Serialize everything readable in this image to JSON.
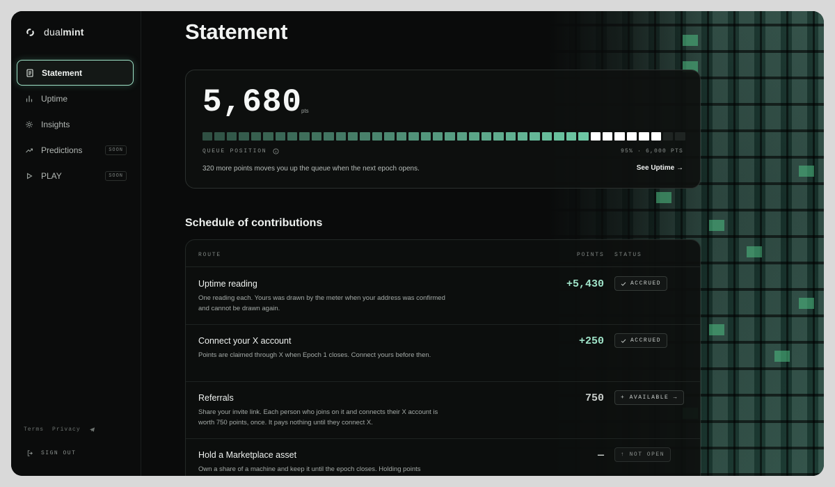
{
  "brand": {
    "prefix": "dual",
    "suffix": "mint"
  },
  "nav": [
    {
      "label": "Statement",
      "icon": "document-icon",
      "active": true
    },
    {
      "label": "Uptime",
      "icon": "bar-chart-icon"
    },
    {
      "label": "Insights",
      "icon": "sparkle-icon"
    },
    {
      "label": "Predictions",
      "icon": "trend-up-icon",
      "badge": "SOON"
    },
    {
      "label": "PLAY",
      "icon": "play-icon",
      "badge": "SOON"
    }
  ],
  "footer": {
    "terms": "Terms",
    "privacy": "Privacy",
    "sign_out": "SIGN OUT"
  },
  "page": {
    "title": "Statement"
  },
  "summary": {
    "points": "5,680",
    "unit": "pts",
    "progress_fraction": 0.95,
    "queue_label": "QUEUE POSITION",
    "queue_meta": "95% · 6,000 PTS",
    "description": "320 more points moves you up the queue when the next epoch opens.",
    "link": "See Uptime →"
  },
  "schedule": {
    "title": "Schedule of contributions",
    "columns": {
      "route": "ROUTE",
      "points": "POINTS",
      "status": "STATUS"
    },
    "rows": [
      {
        "title": "Uptime reading",
        "description": "One reading each. Yours was drawn by the meter when your address was confirmed and cannot be drawn again.",
        "points": "+5,430",
        "status": "ACCRUED",
        "status_icon": "check-icon",
        "points_color": "#9fe3c8"
      },
      {
        "title": "Connect your X account",
        "description": "Points are claimed through X when Epoch 1 closes. Connect yours before then.",
        "points": "+250",
        "status": "ACCRUED",
        "status_icon": "check-icon",
        "points_color": "#9fe3c8"
      },
      {
        "title": "Referrals",
        "description": "Share your invite link. Each person who joins on it and connects their X account is worth 750 points, once. It pays nothing until they connect X.",
        "points": "750",
        "status": "+ AVAILABLE →",
        "status_icon": "",
        "points_color": "#c9cecb"
      },
      {
        "title": "Hold a Marketplace asset",
        "description": "Own a share of a machine and keep it until the epoch closes. Holding points",
        "points": "—",
        "status": "↑ NOT OPEN",
        "status_icon": "",
        "points_color": "#c9cecb"
      }
    ]
  },
  "colors": {
    "accent": "#9fe3c8",
    "bar_filled": "#6fcba7",
    "bar_bright": "#ffffff",
    "bar_empty": "#1f2422"
  }
}
